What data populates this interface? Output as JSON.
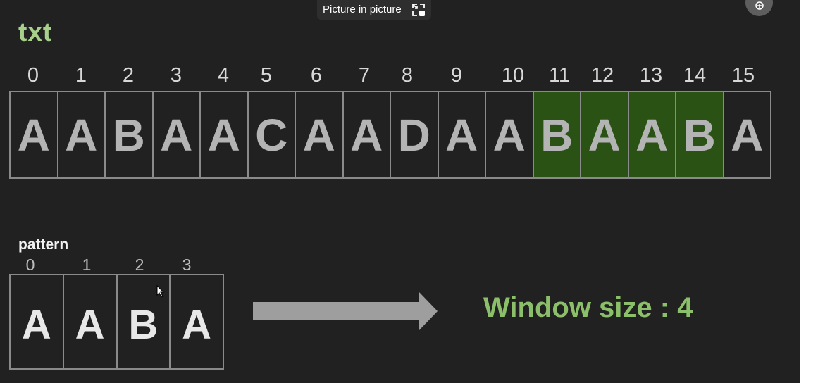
{
  "txt": {
    "label": "txt",
    "indices": [
      "0",
      "1",
      "2",
      "3",
      "4",
      "5",
      "6",
      "7",
      "8",
      "9",
      "10",
      "11",
      "12",
      "13",
      "14",
      "15"
    ],
    "chars": [
      "A",
      "A",
      "B",
      "A",
      "A",
      "C",
      "A",
      "A",
      "D",
      "A",
      "A",
      "B",
      "A",
      "A",
      "B",
      "A"
    ],
    "highlighted_indices": [
      11,
      12,
      13,
      14
    ],
    "highlight_color": "#2a5214"
  },
  "pattern": {
    "label": "pattern",
    "indices": [
      "0",
      "1",
      "2",
      "3"
    ],
    "chars": [
      "A",
      "A",
      "B",
      "A"
    ]
  },
  "window_size_text": "Window size : 4",
  "pip_tooltip": {
    "text": "Picture in picture",
    "icon": "picture-in-picture-icon"
  },
  "colors": {
    "background": "#212121",
    "title_green": "#a8d08d",
    "window_text_green": "#8cbf6a"
  }
}
